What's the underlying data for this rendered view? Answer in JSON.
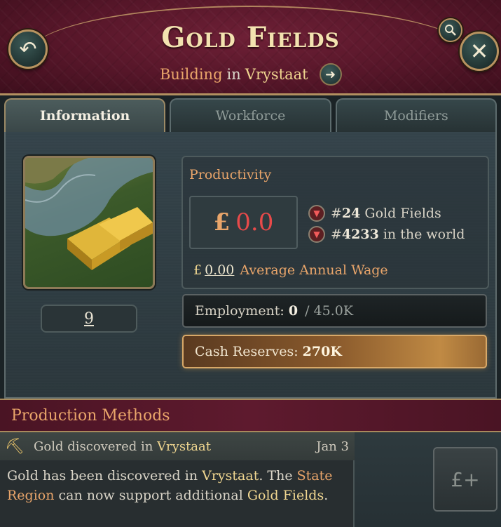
{
  "header": {
    "title": "Gold Fields",
    "subtitle_type": "Building",
    "subtitle_in": "in",
    "subtitle_location": "Vrystaat",
    "back_icon": "undo-arrow-icon",
    "close_icon": "close-x-icon",
    "search_icon": "magnifier-icon",
    "goto_icon": "arrow-right-icon"
  },
  "tabs": [
    {
      "label": "Information",
      "active": true
    },
    {
      "label": "Workforce",
      "active": false
    },
    {
      "label": "Modifiers",
      "active": false
    }
  ],
  "info": {
    "level": "9",
    "productivity_label": "Productivity",
    "productivity_currency": "£",
    "productivity_value": "0.0",
    "rank_local_prefix": "#",
    "rank_local_num": "24",
    "rank_local_text": "Gold Fields",
    "rank_world_prefix": "#",
    "rank_world_num": "4233",
    "rank_world_text": "in the world",
    "wage_currency": "£",
    "wage_value": "0.00",
    "wage_label": "Average Annual Wage",
    "employment_label": "Employment:",
    "employment_value": "0",
    "employment_max": "/ 45.0K",
    "cash_label": "Cash Reserves:",
    "cash_value": "270K"
  },
  "production": {
    "header": "Production Methods",
    "notification": {
      "title_prefix": "Gold discovered in",
      "title_location": "Vrystaat",
      "date": "Jan 3",
      "body_1": "Gold has been discovered in",
      "body_loc": "Vrystaat",
      "body_2": ". The",
      "body_region": "State Region",
      "body_3": "can now support additional",
      "body_building": "Gold Fields",
      "body_4": "."
    },
    "slot_icon": "money-plus-icon",
    "slot_text": "£+"
  },
  "colors": {
    "accent_orange": "#e9a56a",
    "accent_gold": "#f0d690",
    "negative_red": "#e84a4a",
    "header_maroon": "#5e1a2e"
  }
}
